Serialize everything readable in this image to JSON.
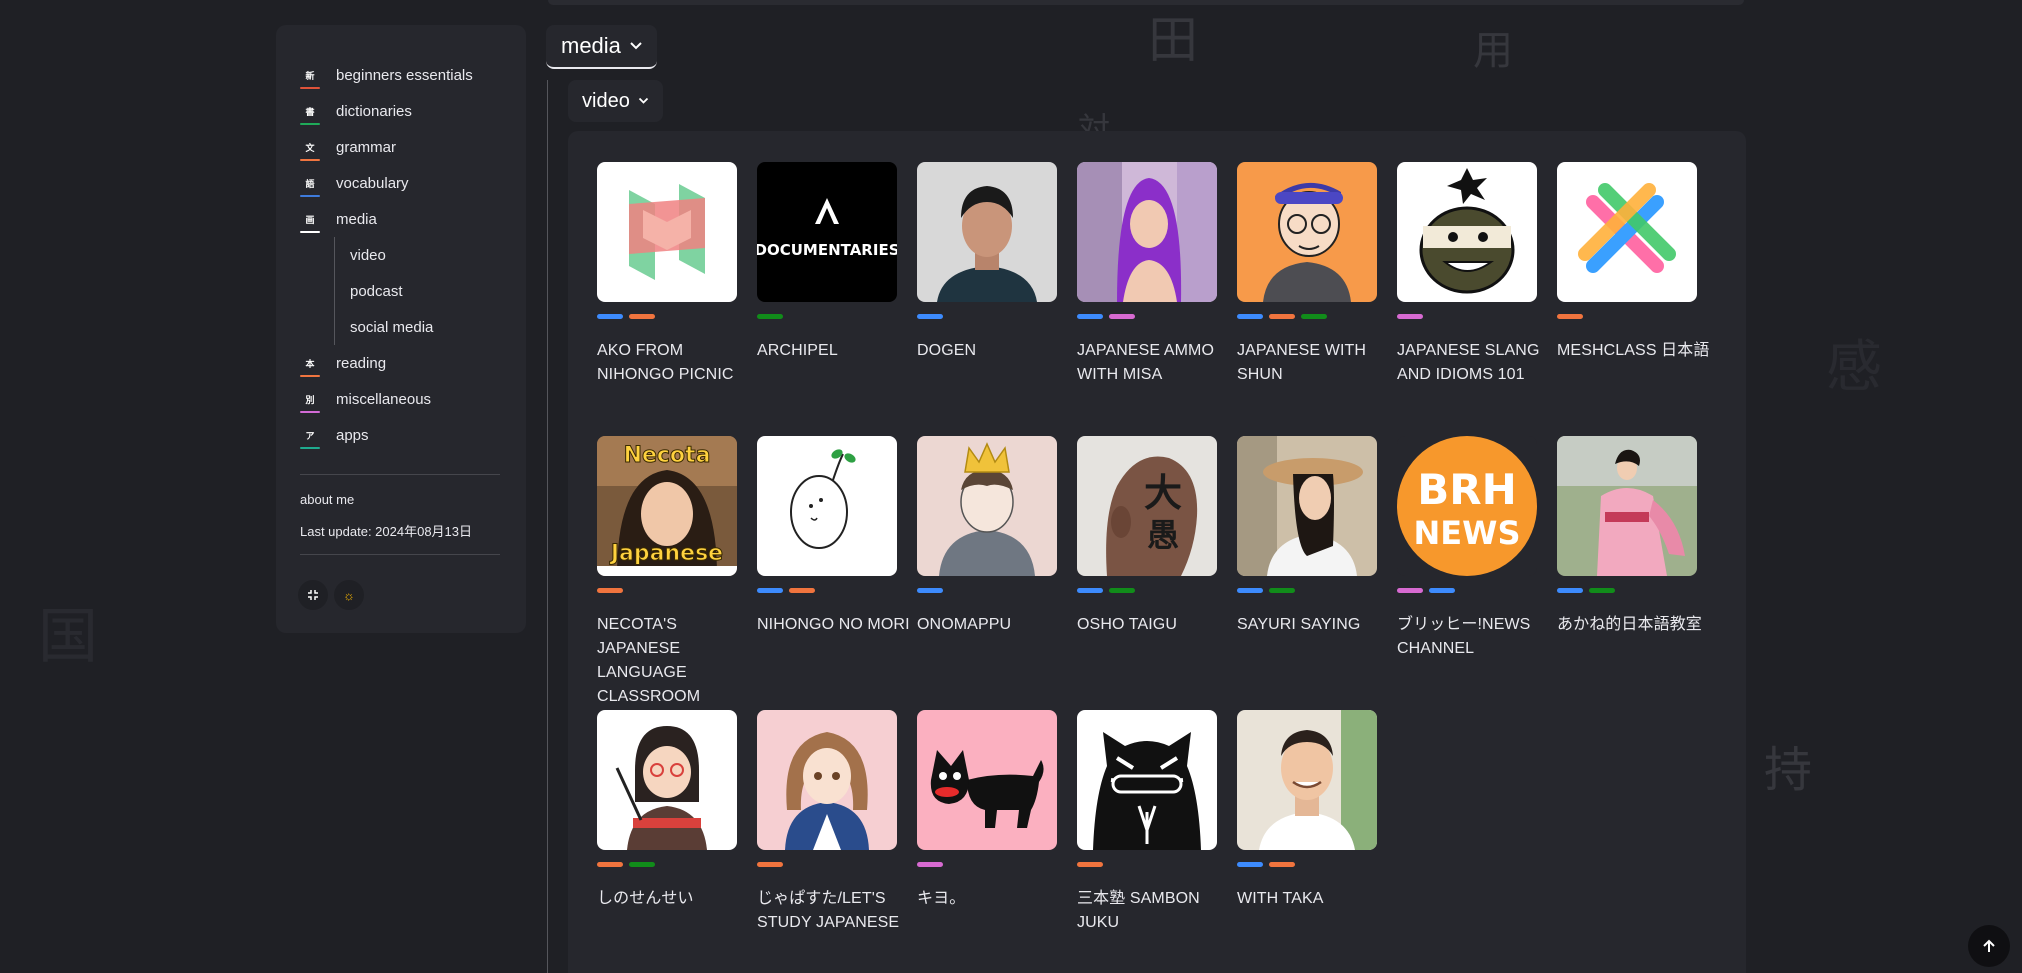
{
  "background_kanji": [
    "田",
    "用",
    "対",
    "感",
    "国",
    "持"
  ],
  "sidebar": {
    "items": [
      {
        "glyph": "新",
        "label": "beginners essentials",
        "color": "#e0533a"
      },
      {
        "glyph": "書",
        "label": "dictionaries",
        "color": "#1faa59"
      },
      {
        "glyph": "文",
        "label": "grammar",
        "color": "#f07540"
      },
      {
        "glyph": "語",
        "label": "vocabulary",
        "color": "#3e7bdc"
      },
      {
        "glyph": "画",
        "label": "media",
        "color": "#ffffff"
      },
      {
        "glyph": "本",
        "label": "reading",
        "color": "#f07540"
      },
      {
        "glyph": "別",
        "label": "miscellaneous",
        "color": "#d36bd6"
      },
      {
        "glyph": "ア",
        "label": "apps",
        "color": "#1faa8f"
      }
    ],
    "subitems": [
      "video",
      "podcast",
      "social media"
    ],
    "about": "about me",
    "last_update": "Last update: 2024年08月13日",
    "buttons": {
      "collapse_icon": "collapse-icon",
      "theme_icon": "sun-icon"
    }
  },
  "main": {
    "category_select": "media",
    "subcategory_select": "video"
  },
  "tag_colors": {
    "blue": "#3d8bfd",
    "orange": "#f0743e",
    "green": "#118c1a",
    "pink": "#d76ad1"
  },
  "channels": [
    {
      "name": "AKO FROM NIHONGO PICNIC",
      "tags": [
        "blue",
        "orange"
      ],
      "icon": "picnic-logo"
    },
    {
      "name": "ARCHIPEL",
      "tags": [
        "green"
      ],
      "icon": "archipel-documentaries-logo"
    },
    {
      "name": "DOGEN",
      "tags": [
        "blue"
      ],
      "icon": "dogen-portrait"
    },
    {
      "name": "JAPANESE AMMO WITH MISA",
      "tags": [
        "blue",
        "pink"
      ],
      "icon": "misa-portrait"
    },
    {
      "name": "JAPANESE WITH SHUN",
      "tags": [
        "blue",
        "orange",
        "green"
      ],
      "icon": "shun-cartoon"
    },
    {
      "name": "JAPANESE SLANG AND IDIOMS 101",
      "tags": [
        "pink"
      ],
      "icon": "ninja-cartoon"
    },
    {
      "name": "MESHCLASS 日本語",
      "tags": [
        "orange"
      ],
      "icon": "meshclass-logo"
    },
    {
      "name": "NECOTA'S JAPANESE LANGUAGE CLASSROOM",
      "tags": [
        "orange"
      ],
      "icon": "necota-portrait",
      "thumb_text_top": "Necota",
      "thumb_text_bottom": "Japanese"
    },
    {
      "name": "NIHONGO NO MORI",
      "tags": [
        "blue",
        "orange"
      ],
      "icon": "sprout-mascot"
    },
    {
      "name": "ONOMAPPU",
      "tags": [
        "blue"
      ],
      "icon": "crowned-boy-drawing"
    },
    {
      "name": "OSHO TAIGU",
      "tags": [
        "blue",
        "green"
      ],
      "icon": "tattooed-head"
    },
    {
      "name": "SAYURI SAYING",
      "tags": [
        "blue",
        "green"
      ],
      "icon": "sayuri-portrait"
    },
    {
      "name": "ブリッヒー!NEWS CHANNEL",
      "tags": [
        "pink",
        "blue"
      ],
      "icon": "brh-news-logo",
      "thumb_text_top": "BRH",
      "thumb_text_bottom": "NEWS"
    },
    {
      "name": "あかね的日本語教室",
      "tags": [
        "blue",
        "green"
      ],
      "icon": "kimono-portrait"
    },
    {
      "name": "しのせんせい",
      "tags": [
        "orange",
        "green"
      ],
      "icon": "teacher-illustration"
    },
    {
      "name": "じゃぱすた/LET'S STUDY JAPANESE",
      "tags": [
        "orange"
      ],
      "icon": "girl-illustration"
    },
    {
      "name": "キヨ。",
      "tags": [
        "pink"
      ],
      "icon": "black-cat-drawing"
    },
    {
      "name": "三本塾 SAMBON JUKU",
      "tags": [
        "orange"
      ],
      "icon": "tiger-logo"
    },
    {
      "name": "WITH TAKA",
      "tags": [
        "blue",
        "orange"
      ],
      "icon": "taka-portrait"
    }
  ],
  "scroll_top_icon": "arrow-up-icon"
}
